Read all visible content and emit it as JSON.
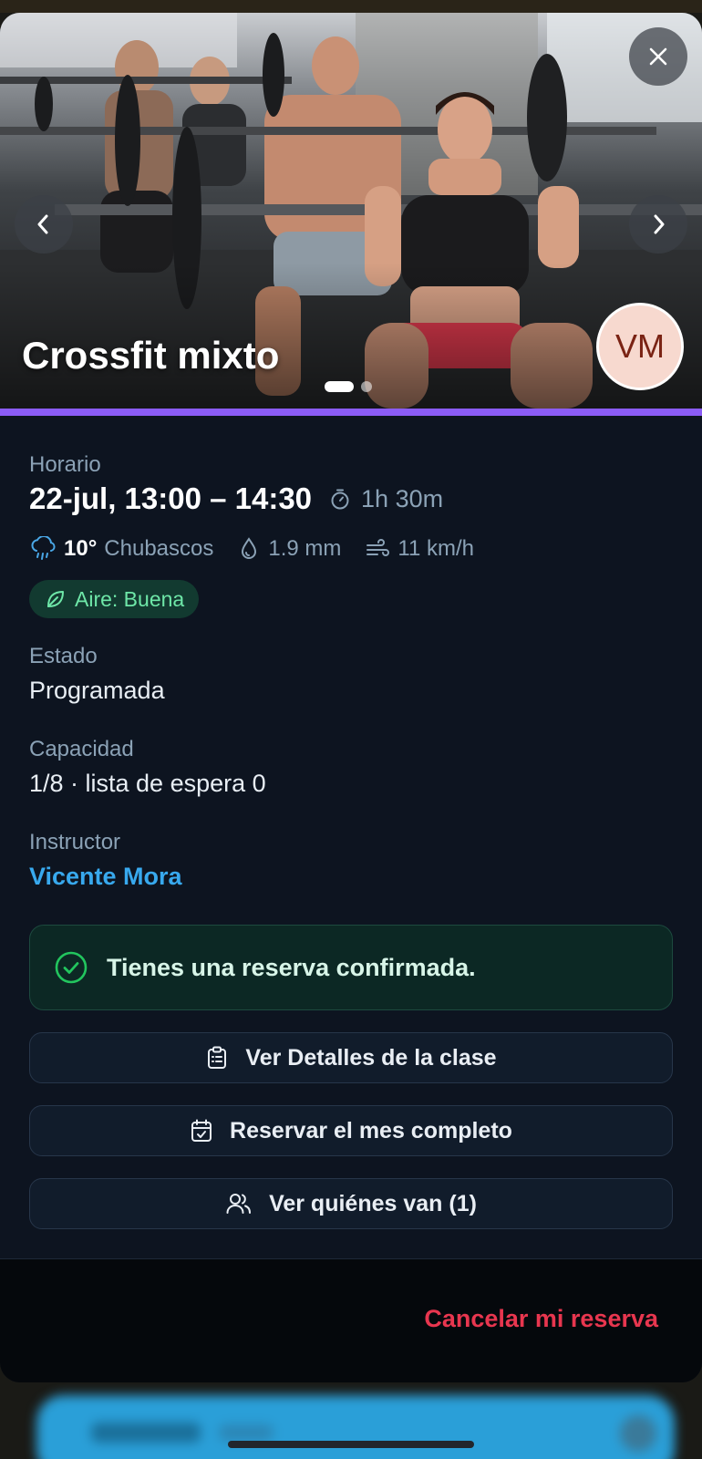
{
  "hero": {
    "title": "Crossfit mixto",
    "avatar_initials": "VM",
    "carousel_pages": 2,
    "carousel_active_index": 0,
    "image_description": "gym-weightlifting-photo",
    "accent_color": "#8b5cf6"
  },
  "schedule": {
    "label": "Horario",
    "time": "22-jul, 13:00 – 14:30",
    "duration": "1h 30m",
    "duration_icon": "stopwatch-icon"
  },
  "weather": {
    "temp": "10°",
    "condition": "Chubascos",
    "rain": "1.9 mm",
    "wind": "11 km/h",
    "air": "Aire: Buena"
  },
  "status": {
    "label": "Estado",
    "value": "Programada"
  },
  "capacity": {
    "label": "Capacidad",
    "value": "1/8 · lista de espera 0"
  },
  "instructor": {
    "label": "Instructor",
    "name": "Vicente Mora"
  },
  "confirmation": {
    "text": "Tienes una reserva confirmada.",
    "color": "#22c55e"
  },
  "actions": {
    "details": "Ver Detalles de la clase",
    "book_month": "Reservar el mes completo",
    "attendees": "Ver quiénes van (1)"
  },
  "footer": {
    "cancel": "Cancelar mi reserva",
    "cancel_color": "#e8364f"
  }
}
